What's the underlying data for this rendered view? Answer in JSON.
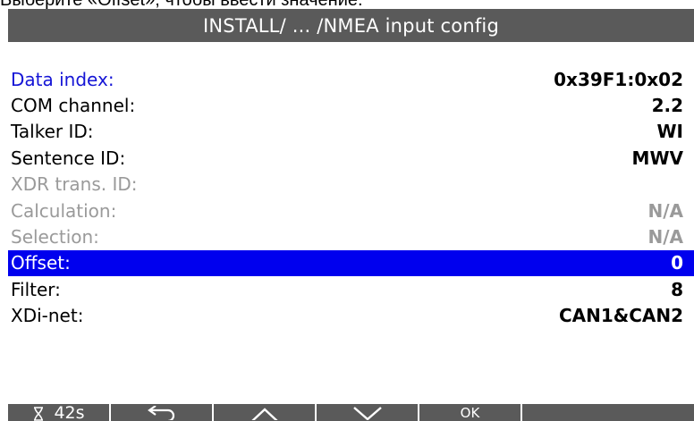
{
  "caption": "Выберите «Offset», чтобы ввести значение.",
  "window": {
    "title": "INSTALL/ ... /NMEA input config"
  },
  "rows": [
    {
      "label": "Data index:",
      "value": "0x39F1:0x02"
    },
    {
      "label": "COM channel:",
      "value": "2.2"
    },
    {
      "label": "Talker ID:",
      "value": "WI"
    },
    {
      "label": "Sentence ID:",
      "value": "MWV"
    },
    {
      "label": "XDR trans. ID:",
      "value": ""
    },
    {
      "label": "Calculation:",
      "value": "N/A"
    },
    {
      "label": "Selection:",
      "value": "N/A"
    },
    {
      "label": "Offset:",
      "value": "0"
    },
    {
      "label": "Filter:",
      "value": "8"
    },
    {
      "label": "XDi-net:",
      "value": "CAN1&CAN2"
    }
  ],
  "footer": {
    "timer_icon": "hourglass-icon",
    "timer": "42s",
    "back_icon": "return-arrow-icon",
    "up_icon": "chevron-up-icon",
    "down_icon": "chevron-down-icon",
    "ok": "OK"
  },
  "colors": {
    "titlebar": "#5a5a5a",
    "selected_row": "#0000ee",
    "label_highlight": "#1515d6",
    "disabled_text": "#9a9a9a"
  }
}
